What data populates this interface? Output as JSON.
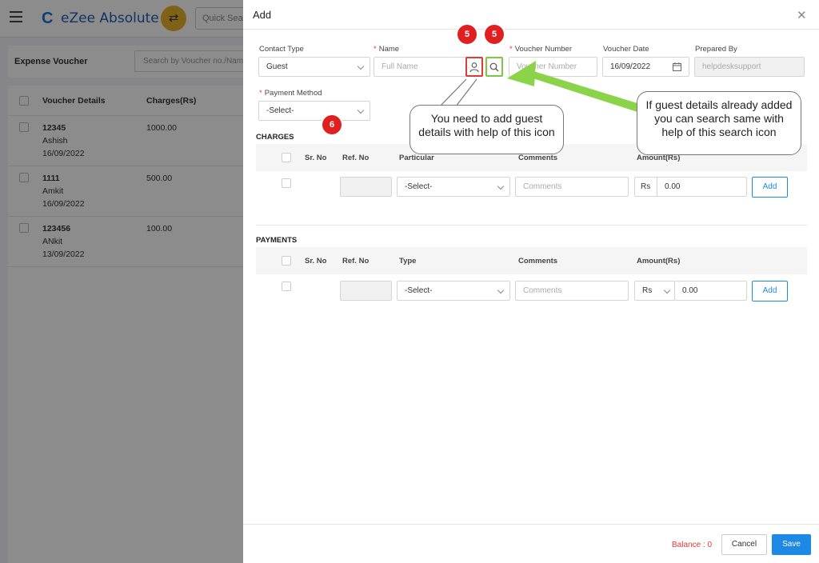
{
  "app": {
    "logo_mark": "C",
    "logo_text": "eZee Absolute",
    "quick_search_placeholder": "Quick Search",
    "list_title": "Expense Voucher",
    "list_search_placeholder": "Search by Voucher no./Name",
    "columns": [
      "Voucher Details",
      "Charges(Rs)"
    ],
    "vouchers": [
      {
        "number": "12345",
        "name": "Ashish",
        "date": "16/09/2022",
        "charges": "1000.00"
      },
      {
        "number": "1111",
        "name": "Amkit",
        "date": "16/09/2022",
        "charges": "500.00"
      },
      {
        "number": "123456",
        "name": "ANkit",
        "date": "13/09/2022",
        "charges": "100.00"
      }
    ]
  },
  "modal": {
    "title": "Add",
    "close_icon": "close-icon",
    "fields": {
      "contact_type": {
        "label": "Contact Type",
        "value": "Guest"
      },
      "name": {
        "label": "Name",
        "placeholder": "Full Name"
      },
      "voucher_number": {
        "label": "Voucher Number",
        "placeholder": "Voucher Number"
      },
      "voucher_date": {
        "label": "Voucher Date",
        "value": "16/09/2022"
      },
      "prepared_by": {
        "label": "Prepared By",
        "value": "helpdesksupport"
      },
      "payment_method": {
        "label": "Payment Method",
        "value": "-Select-"
      }
    },
    "required_mark": "*",
    "charges": {
      "title": "CHARGES",
      "headers": [
        "Sr. No",
        "Ref. No",
        "Particular",
        "Comments",
        "Amount(Rs)"
      ],
      "row": {
        "particular": "-Select-",
        "comments_placeholder": "Comments",
        "currency": "Rs",
        "amount": "0.00",
        "add_label": "Add"
      }
    },
    "payments": {
      "title": "PAYMENTS",
      "headers": [
        "Sr. No",
        "Ref. No",
        "Type",
        "Comments",
        "Amount(Rs)"
      ],
      "row": {
        "type": "-Select-",
        "comments_placeholder": "Comments",
        "currency": "Rs",
        "amount": "0.00",
        "add_label": "Add"
      }
    },
    "footer": {
      "balance": "Balance : 0",
      "cancel_label": "Cancel",
      "save_label": "Save"
    }
  },
  "annotations": {
    "badge_guest": "5",
    "badge_search": "5",
    "badge_payment": "6",
    "callout_add_guest": "You need to add guest details with help of this icon",
    "callout_search": "If guest details already added you can search same with help of this search icon",
    "colors": {
      "badge": "#e02020",
      "add_guest_highlight": "#e53935",
      "search_highlight": "#7ac943",
      "arrow": "#8bd44a"
    }
  }
}
